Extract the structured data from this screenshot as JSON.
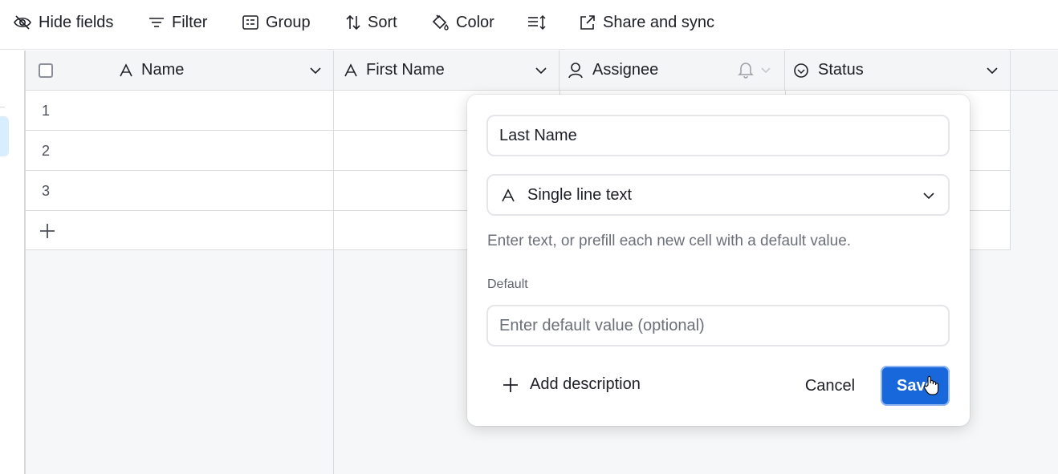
{
  "toolbar": {
    "hide_fields": "Hide fields",
    "filter": "Filter",
    "group": "Group",
    "sort": "Sort",
    "color": "Color",
    "row_height_icon": "row-height-icon",
    "share_sync": "Share and sync"
  },
  "columns": [
    {
      "label": "Name",
      "icon": "text-field-icon"
    },
    {
      "label": "First Name",
      "icon": "text-field-icon"
    },
    {
      "label": "Assignee",
      "icon": "user-field-icon"
    },
    {
      "label": "Status",
      "icon": "status-field-icon"
    }
  ],
  "rows": [
    "1",
    "2",
    "3"
  ],
  "add_row_icon": "plus-icon",
  "field_editor": {
    "field_name": "Last Name",
    "field_type": "Single line text",
    "type_hint": "Enter text, or prefill each new cell with a default value.",
    "default_label": "Default",
    "default_placeholder": "Enter default value (optional)",
    "add_description": "Add description",
    "cancel": "Cancel",
    "save": "Save"
  },
  "colors": {
    "accent": "#1868db",
    "selected_row": "#d8eefe"
  }
}
